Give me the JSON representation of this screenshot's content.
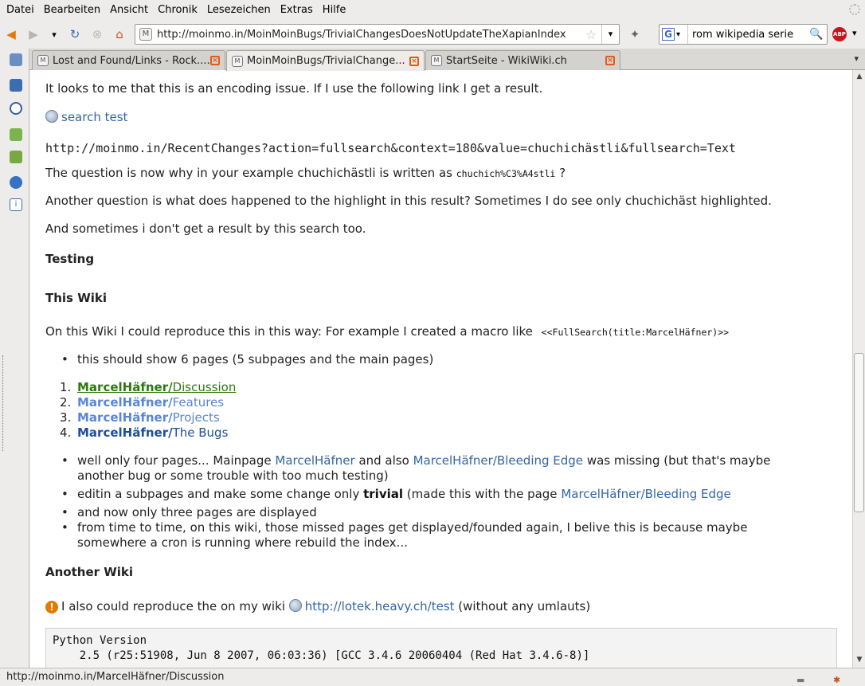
{
  "menu": [
    "Datei",
    "Bearbeiten",
    "Ansicht",
    "Chronik",
    "Lesezeichen",
    "Extras",
    "Hilfe"
  ],
  "nav": {
    "url": "http://moinmo.in/MoinMoinBugs/TrivialChangesDoesNotUpdateTheXapianIndex",
    "search_query": "rom wikipedia serie",
    "search_engine_letter": "G",
    "adblock_label": "ABP"
  },
  "tabs": [
    {
      "label": "Lost and Found/Links - Rock....",
      "active": false
    },
    {
      "label": "MoinMoinBugs/TrivialChange...",
      "active": true
    },
    {
      "label": "StartSeite - WikiWiki.ch",
      "active": false
    }
  ],
  "content": {
    "p1": "It looks to me that this is an encoding issue. If I use the following link I get a result.",
    "search_test_link": "search test",
    "url_line": "http://moinmo.in/RecentChanges?action=fullsearch&context=180&value=chuchichästli&fullsearch=Text",
    "p2_before": "The question is now why in your example chuchichästli is written as ",
    "p2_code": "chuchich%C3%A4stli",
    "p2_after": " ?",
    "p3": "Another question is what does happened to the highlight in this result? Sometimes I do see only chuchichäst highlighted.",
    "p4": "And sometimes i don't get a result by this search too.",
    "h_testing": "Testing",
    "h_this_wiki": "This Wiki",
    "p5_before": "On this Wiki I could reproduce this in this way: For example I created a macro like ",
    "p5_code": "<<FullSearch(title:MarcelHäfner)>>",
    "bullet1": "this should show 6 pages (5 subpages and the main pages)",
    "numbered": [
      {
        "num": "1.",
        "parent": "MarcelHäfner/",
        "child": "Discussion",
        "color": "#2d7a0e"
      },
      {
        "num": "2.",
        "parent": "MarcelHäfner/",
        "child": "Features",
        "color": "#5a86d6"
      },
      {
        "num": "3.",
        "parent": "MarcelHäfner/",
        "child": "Projects",
        "color": "#5a86d6"
      },
      {
        "num": "4.",
        "parent": "MarcelHäfner/",
        "child": "The Bugs",
        "color": "#1a4f9c"
      }
    ],
    "b2_a": "well only four pages... Mainpage ",
    "b2_link1": "MarcelHäfner",
    "b2_b": " and also ",
    "b2_link2": "MarcelHäfner/Bleeding Edge",
    "b2_c": " was missing (but that's maybe",
    "b2_line2": "another bug or some trouble with too much testing)",
    "b3_a": "editin a subpages and make some change only ",
    "b3_bold": "trivial",
    "b3_b": " (made this with the page ",
    "b3_link": "MarcelHäfner/Bleeding Edge",
    "b4": "and now only three pages are displayed",
    "b5_line1": "from time to time, on this wiki, those missed pages get displayed/founded again, I belive this is because maybe",
    "b5_line2": "somewhere a cron is running where rebuild the index...",
    "h_another": "Another Wiki",
    "p6_before": "I also could reproduce the on my wiki ",
    "p6_link": "http://lotek.heavy.ch/test",
    "p6_after": " (without any umlauts)",
    "code_line1": "Python Version",
    "code_line2": "    2.5 (r25:51908, Jun 8 2007, 06:03:36) [GCC 3.4.6 20060404 (Red Hat 3.4.6-8)]"
  },
  "status": {
    "text": "http://moinmo.in/MarcelHäfner/Discussion"
  }
}
